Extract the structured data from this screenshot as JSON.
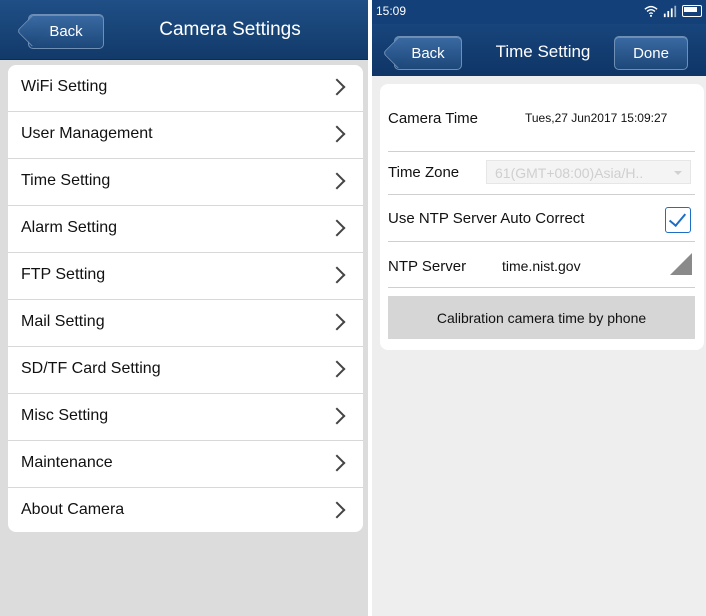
{
  "left": {
    "back_label": "Back",
    "title": "Camera Settings",
    "menu": [
      {
        "label": "WiFi Setting"
      },
      {
        "label": "User Management"
      },
      {
        "label": "Time Setting"
      },
      {
        "label": "Alarm Setting"
      },
      {
        "label": "FTP Setting"
      },
      {
        "label": "Mail Setting"
      },
      {
        "label": "SD/TF Card Setting"
      },
      {
        "label": "Misc Setting"
      },
      {
        "label": "Maintenance"
      },
      {
        "label": "About Camera"
      }
    ]
  },
  "right": {
    "status_time": "15:09",
    "back_label": "Back",
    "title": "Time Setting",
    "done_label": "Done",
    "camera_time_label": "Camera Time",
    "camera_time_value": "Tues,27 Jun2017 15:09:27",
    "time_zone_label": "Time Zone",
    "time_zone_value": "61(GMT+08:00)Asia/H..",
    "ntp_auto_label": "Use NTP Server Auto Correct",
    "ntp_auto_checked": true,
    "ntp_server_label": "NTP Server",
    "ntp_server_value": "time.nist.gov",
    "calibrate_label": "Calibration camera time by phone"
  },
  "colors": {
    "navbar": "#134078",
    "accent_check": "#1c6fc4",
    "background": "#dcdcdc"
  }
}
